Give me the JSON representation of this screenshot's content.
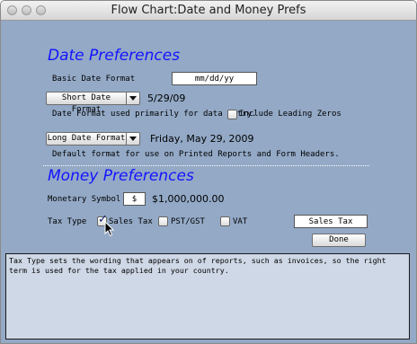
{
  "window": {
    "title": "Flow Chart:Date and Money Prefs"
  },
  "date": {
    "heading": "Date Preferences",
    "basic_label": "Basic Date Format",
    "basic_value": "mm/dd/yy",
    "short_button": "Short Date Format",
    "short_example": "5/29/09",
    "short_desc": "Date Format used primarily for data entry.",
    "leading_zeros_label": "Include Leading Zeros",
    "leading_zeros_checked": false,
    "long_button": "Long Date Format",
    "long_example": "Friday, May 29, 2009",
    "long_desc": "Default format for use on Printed Reports and Form Headers."
  },
  "money": {
    "heading": "Money Preferences",
    "symbol_label": "Monetary Symbol",
    "symbol_value": "$",
    "amount_example": "$1,000,000.00",
    "tax_label": "Tax Type",
    "options": [
      {
        "label": "Sales Tax",
        "checked": true
      },
      {
        "label": "PST/GST",
        "checked": false
      },
      {
        "label": "VAT",
        "checked": false
      }
    ],
    "tax_display": "Sales Tax",
    "done_button": "Done"
  },
  "info_text": "Tax Type sets the wording that appears on of reports, such as invoices, so the right term is used for the tax applied in your country.",
  "icons": [
    "close-icon",
    "minimize-icon",
    "zoom-icon",
    "dropdown-arrow-icon",
    "checkmark-icon",
    "mouse-pointer-icon"
  ]
}
